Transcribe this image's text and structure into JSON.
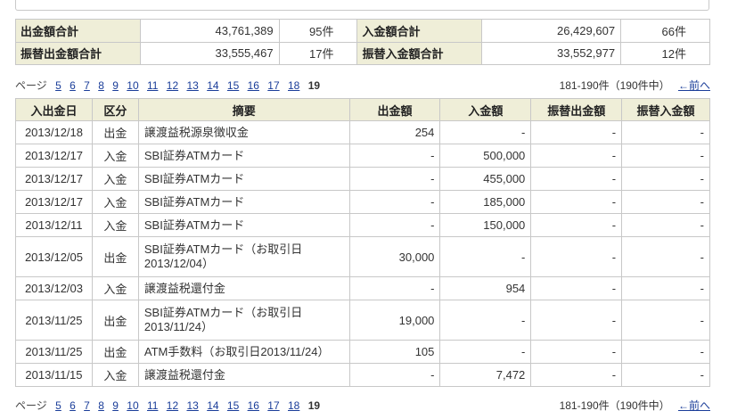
{
  "summary": {
    "withdraw_total_label": "出金額合計",
    "withdraw_total_value": "43,761,389",
    "withdraw_total_count": "95件",
    "deposit_total_label": "入金額合計",
    "deposit_total_value": "26,429,607",
    "deposit_total_count": "66件",
    "transfer_out_label": "振替出金額合計",
    "transfer_out_value": "33,555,467",
    "transfer_out_count": "17件",
    "transfer_in_label": "振替入金額合計",
    "transfer_in_value": "33,552,977",
    "transfer_in_count": "12件"
  },
  "pager": {
    "label": "ページ",
    "pages": [
      "5",
      "6",
      "7",
      "8",
      "9",
      "10",
      "11",
      "12",
      "13",
      "14",
      "15",
      "16",
      "17",
      "18"
    ],
    "current": "19",
    "range": "181-190件（190件中）",
    "prev": "←前へ"
  },
  "table": {
    "headers": [
      "入出金日",
      "区分",
      "摘要",
      "出金額",
      "入金額",
      "振替出金額",
      "振替入金額"
    ],
    "rows": [
      {
        "date": "2013/12/18",
        "type": "出金",
        "desc": "譲渡益税源泉徴収金",
        "out": "254",
        "in": "-",
        "tout": "-",
        "tin": "-"
      },
      {
        "date": "2013/12/17",
        "type": "入金",
        "desc": "SBI証券ATMカード",
        "out": "-",
        "in": "500,000",
        "tout": "-",
        "tin": "-"
      },
      {
        "date": "2013/12/17",
        "type": "入金",
        "desc": "SBI証券ATMカード",
        "out": "-",
        "in": "455,000",
        "tout": "-",
        "tin": "-"
      },
      {
        "date": "2013/12/17",
        "type": "入金",
        "desc": "SBI証券ATMカード",
        "out": "-",
        "in": "185,000",
        "tout": "-",
        "tin": "-"
      },
      {
        "date": "2013/12/11",
        "type": "入金",
        "desc": "SBI証券ATMカード",
        "out": "-",
        "in": "150,000",
        "tout": "-",
        "tin": "-"
      },
      {
        "date": "2013/12/05",
        "type": "出金",
        "desc": "SBI証券ATMカード（お取引日",
        "desc2": "2013/12/04）",
        "out": "30,000",
        "in": "-",
        "tout": "-",
        "tin": "-"
      },
      {
        "date": "2013/12/03",
        "type": "入金",
        "desc": "譲渡益税還付金",
        "out": "-",
        "in": "954",
        "tout": "-",
        "tin": "-"
      },
      {
        "date": "2013/11/25",
        "type": "出金",
        "desc": "SBI証券ATMカード（お取引日",
        "desc2": "2013/11/24）",
        "out": "19,000",
        "in": "-",
        "tout": "-",
        "tin": "-"
      },
      {
        "date": "2013/11/25",
        "type": "出金",
        "desc": "ATM手数料（お取引日2013/11/24）",
        "out": "105",
        "in": "-",
        "tout": "-",
        "tin": "-"
      },
      {
        "date": "2013/11/15",
        "type": "入金",
        "desc": "譲渡益税還付金",
        "out": "-",
        "in": "7,472",
        "tout": "-",
        "tin": "-"
      }
    ]
  }
}
